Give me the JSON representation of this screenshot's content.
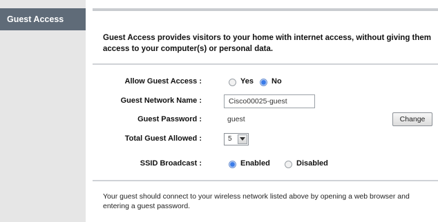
{
  "sidebar": {
    "title": "Guest Access"
  },
  "intro": "Guest Access provides visitors to your home with internet access, without giving them access to your computer(s) or personal data.",
  "form": {
    "allow_label": "Allow Guest Access :",
    "allow_yes": "Yes",
    "allow_no": "No",
    "allow_selected": "No",
    "network_name_label": "Guest Network Name :",
    "network_name_value": "Cisco00025-guest",
    "password_label": "Guest Password :",
    "password_value": "guest",
    "change_button": "Change",
    "total_label": "Total Guest Allowed :",
    "total_value": "5",
    "ssid_label": "SSID Broadcast :",
    "ssid_enabled": "Enabled",
    "ssid_disabled": "Disabled",
    "ssid_selected": "Enabled"
  },
  "footer": "Your guest should connect to your wireless network listed above by opening a web browser and entering a guest password.",
  "colors": {
    "sidebar_title_bg": "#5f6b78",
    "selected_radio": "#3a7be8"
  }
}
